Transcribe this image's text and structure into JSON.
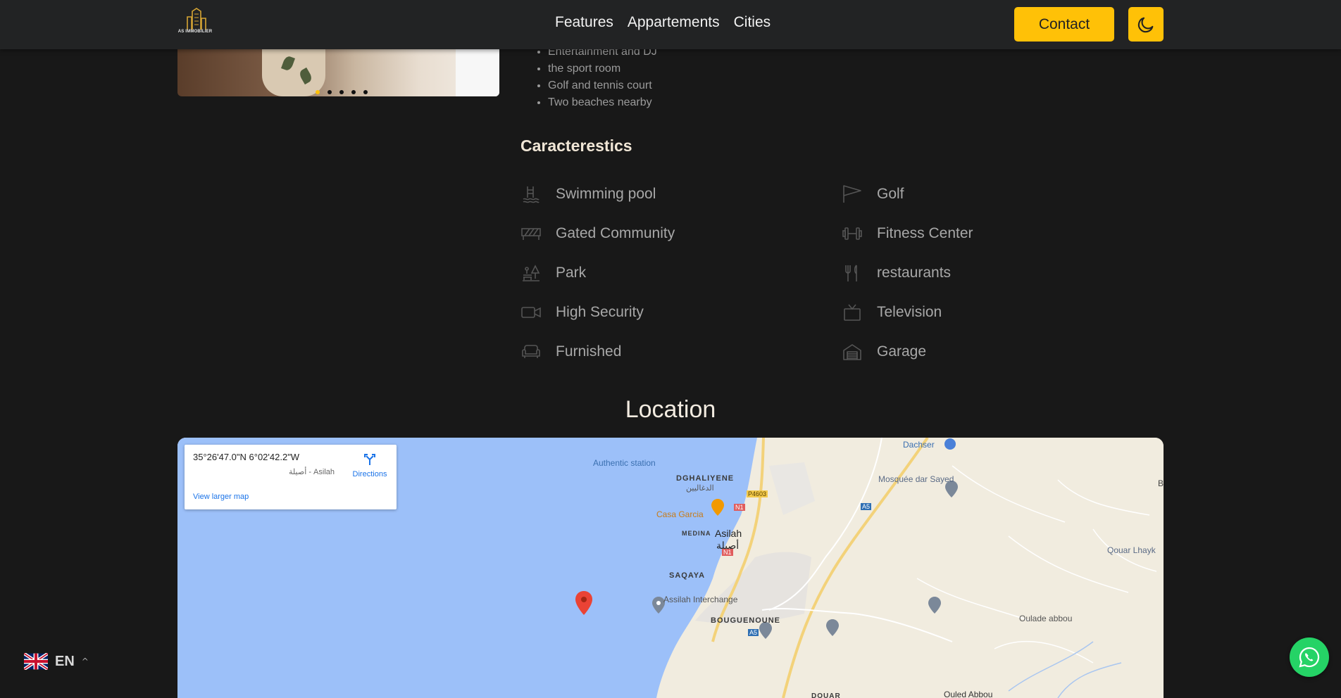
{
  "header": {
    "logo_text": "AS IMMOBILIER",
    "nav": [
      "Features",
      "Appartements",
      "Cities"
    ],
    "contact_label": "Contact",
    "theme_icon": "moon-icon"
  },
  "carousel": {
    "slide_count": 5,
    "active_index": 0
  },
  "amenities": [
    "Entertainment and DJ",
    "the sport room",
    "Golf and tennis court",
    "Two beaches nearby"
  ],
  "characteristics": {
    "title": "Caracterestics",
    "left": [
      {
        "label": "Swimming pool",
        "icon": "swimming-pool-icon"
      },
      {
        "label": "Gated Community",
        "icon": "gate-icon"
      },
      {
        "label": "Park",
        "icon": "park-icon"
      },
      {
        "label": "High Security",
        "icon": "security-camera-icon"
      },
      {
        "label": "Furnished",
        "icon": "sofa-icon"
      }
    ],
    "right": [
      {
        "label": "Golf",
        "icon": "golf-flag-icon"
      },
      {
        "label": "Fitness Center",
        "icon": "dumbbell-icon"
      },
      {
        "label": "restaurants",
        "icon": "fork-knife-icon"
      },
      {
        "label": "Television",
        "icon": "television-icon"
      },
      {
        "label": "Garage",
        "icon": "garage-icon"
      }
    ]
  },
  "location": {
    "title": "Location",
    "card": {
      "coords": "35°26'47.0\"N 6°02'42.2\"W",
      "address": "أصيلة - Asilah",
      "directions": "Directions",
      "larger_map": "View larger map"
    },
    "labels": {
      "authentic": "Authentic station",
      "dachser": "Dachser",
      "dghaliyene": "DGHALIYENE",
      "dghaliyene_ar": "الدغاليين",
      "mosquee": "Mosquée dar Sayed",
      "casa_garcia": "Casa Garcia",
      "medina": "MEDINA",
      "asilah": "Asilah",
      "asilah_ar": "أصيلة",
      "quar": "Qouar Lhayk",
      "saqaya": "SAQAYA",
      "interchange": "Assilah Interchange",
      "bouguenoune": "BOUGUENOUNE",
      "oulade": "Oulade abbou",
      "ouled": "Ouled Abbou",
      "douar": "DOUAR",
      "b_edge": "B",
      "p4603": "P4603",
      "n1a": "N1",
      "n1b": "N1",
      "a5a": "A5",
      "a5b": "A5"
    }
  },
  "language": {
    "code": "EN",
    "flag_icon": "uk-flag-icon"
  },
  "whatsapp": {
    "icon": "whatsapp-icon"
  },
  "colors": {
    "accent": "#ffc107",
    "background": "#181818",
    "header": "#222324",
    "whatsapp": "#25d366"
  }
}
